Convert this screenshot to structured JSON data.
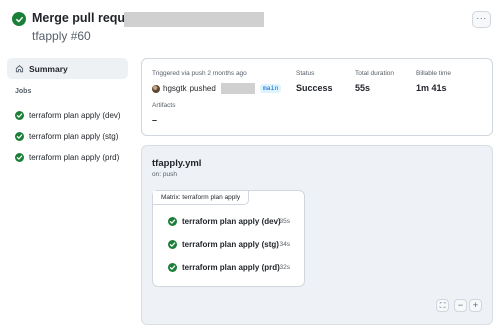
{
  "header": {
    "title": "Merge pull request",
    "subtitle": "tfapply #60",
    "more_label": "···"
  },
  "sidebar": {
    "summary_label": "Summary",
    "jobs_heading": "Jobs",
    "jobs": [
      {
        "label": "terraform plan apply (dev)",
        "status": "success"
      },
      {
        "label": "terraform plan apply (stg)",
        "status": "success"
      },
      {
        "label": "terraform plan apply (prd)",
        "status": "success"
      }
    ]
  },
  "summary": {
    "trigger_text": "Triggered via push 2 months ago",
    "actor": "hgsgtk",
    "action": "pushed",
    "branch": "main",
    "status_label": "Status",
    "status_value": "Success",
    "total_duration_label": "Total duration",
    "total_duration_value": "55s",
    "billable_label": "Billable time",
    "billable_value": "1m 41s",
    "artifacts_label": "Artifacts",
    "artifacts_value": "–"
  },
  "workflow": {
    "file": "tfapply.yml",
    "on": "on: push",
    "matrix_label": "Matrix: terraform plan apply",
    "jobs": [
      {
        "label": "terraform plan apply (dev)",
        "duration": "35s"
      },
      {
        "label": "terraform plan apply (stg)",
        "duration": "34s"
      },
      {
        "label": "terraform plan apply (prd)",
        "duration": "32s"
      }
    ],
    "controls": {
      "fullscreen": "⛶",
      "zoom_out": "−",
      "zoom_in": "+"
    }
  },
  "colors": {
    "success": "#1a7f37",
    "accent": "#0969da"
  }
}
